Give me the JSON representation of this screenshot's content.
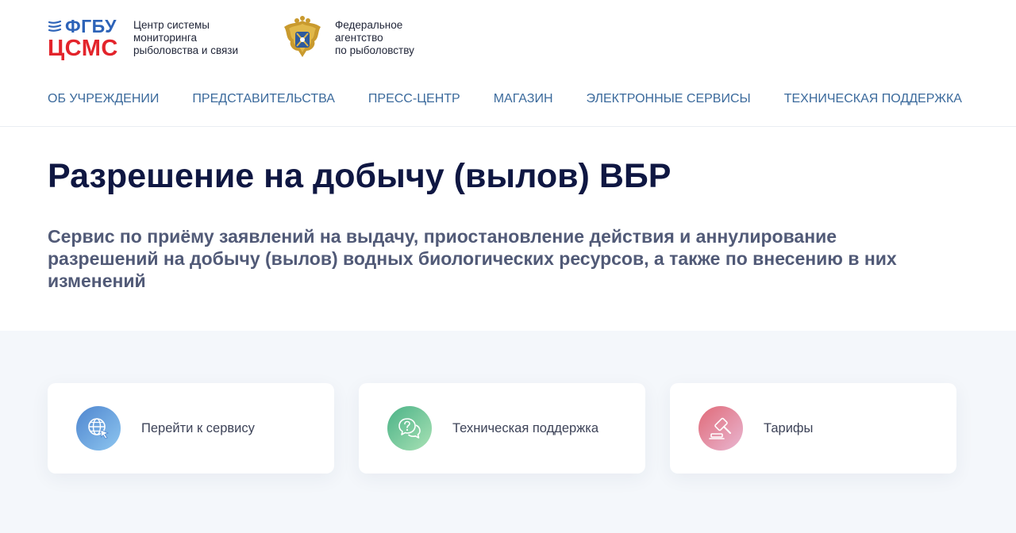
{
  "header": {
    "csms": {
      "fgbu": "ФГБУ",
      "abbr": "ЦСМС",
      "caption": [
        "Центр системы",
        "мониторинга",
        "рыболовства и связи"
      ]
    },
    "agency": {
      "caption": [
        "Федеральное",
        "агентство",
        "по рыболовству"
      ]
    }
  },
  "nav": {
    "items": [
      {
        "label": "Об учреждении"
      },
      {
        "label": "Представительства"
      },
      {
        "label": "Пресс-центр"
      },
      {
        "label": "Магазин"
      },
      {
        "label": "Электронные сервисы"
      },
      {
        "label": "Техническая поддержка"
      }
    ]
  },
  "hero": {
    "title": "Разрешение на добычу (вылов) ВБР",
    "subtitle": "Сервис по приёму заявлений на выдачу, приостановление действия и аннулирование разрешений на добычу (вылов) водных биологических ресурсов, а также по внесению в них изменений"
  },
  "cards": [
    {
      "label": "Перейти к сервису",
      "icon": "globe-cursor-icon"
    },
    {
      "label": "Техническая поддержка",
      "icon": "chat-question-icon"
    },
    {
      "label": "Тарифы",
      "icon": "gavel-icon"
    }
  ],
  "colors": {
    "brand_blue": "#2d63b8",
    "brand_red": "#e3242b",
    "nav": "#3b6a9c",
    "title": "#0f1742",
    "cards_bg": "#f4f7fb"
  }
}
